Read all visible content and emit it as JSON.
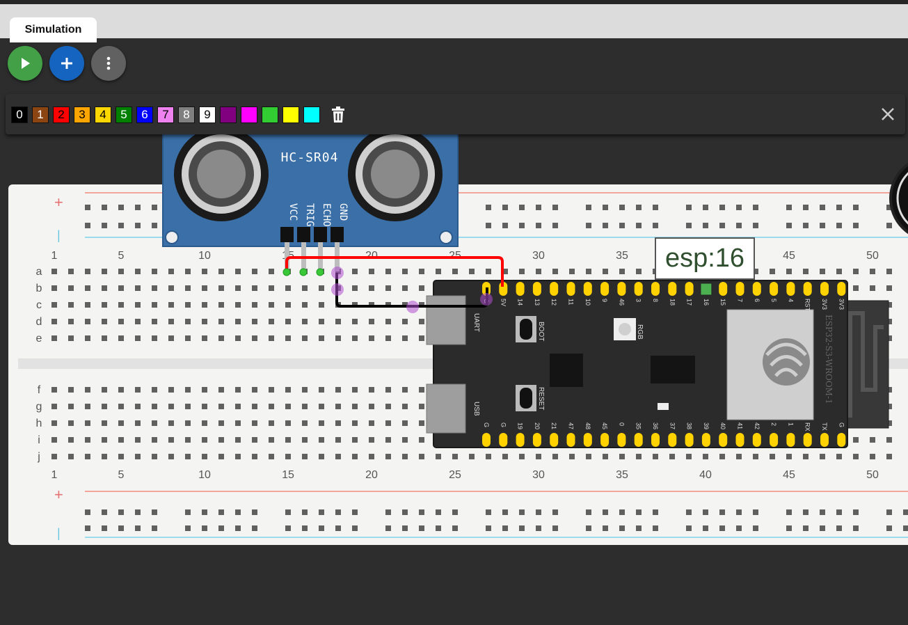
{
  "tabs": [
    {
      "label": "Simulation"
    }
  ],
  "toolbar": {
    "play": {
      "icon": "play-icon",
      "color": "#43a047"
    },
    "add": {
      "icon": "plus-icon",
      "color": "#1565c0"
    },
    "more": {
      "icon": "more-vert-icon",
      "color": "#616161"
    }
  },
  "palette": {
    "swatches": [
      {
        "label": "0",
        "color": "#000000",
        "text_color": "#ffffff"
      },
      {
        "label": "1",
        "color": "#8b4513",
        "text_color": "#ffffff"
      },
      {
        "label": "2",
        "color": "#ff0000",
        "text_color": "#000000"
      },
      {
        "label": "3",
        "color": "#ffa500",
        "text_color": "#000000"
      },
      {
        "label": "4",
        "color": "#ffd700",
        "text_color": "#000000"
      },
      {
        "label": "5",
        "color": "#008000",
        "text_color": "#ffffff"
      },
      {
        "label": "6",
        "color": "#0000ff",
        "text_color": "#ffffff"
      },
      {
        "label": "7",
        "color": "#ee82ee",
        "text_color": "#000000"
      },
      {
        "label": "8",
        "color": "#808080",
        "text_color": "#ffffff"
      },
      {
        "label": "9",
        "color": "#ffffff",
        "text_color": "#000000"
      },
      {
        "label": "",
        "color": "#800080"
      },
      {
        "label": "",
        "color": "#ff00ff"
      },
      {
        "label": "",
        "color": "#32cd32"
      },
      {
        "label": "",
        "color": "#ffff00"
      },
      {
        "label": "",
        "color": "#00ffff"
      }
    ],
    "delete_icon": "trash-icon",
    "close_icon": "close-icon"
  },
  "breadboard": {
    "column_numbers": [
      "1",
      "5",
      "10",
      "15",
      "20",
      "25",
      "30",
      "35",
      "40",
      "45",
      "50"
    ],
    "rows_top": [
      "a",
      "b",
      "c",
      "d",
      "e"
    ],
    "rows_bottom": [
      "f",
      "g",
      "h",
      "i",
      "j"
    ],
    "plus": "+",
    "minus": "|"
  },
  "sensor": {
    "name": "HC-SR04",
    "pins": [
      "VCC",
      "TRIG",
      "ECHO",
      "GND"
    ]
  },
  "esp32": {
    "module_label": "ESP32-S3-WROOM-1",
    "top_pins": [
      "G",
      "5V",
      "14",
      "13",
      "12",
      "11",
      "10",
      "9",
      "46",
      "3",
      "8",
      "18",
      "17",
      "16",
      "15",
      "7",
      "6",
      "5",
      "4",
      "RST",
      "3V3",
      "3V3"
    ],
    "bottom_pins": [
      "G",
      "G",
      "19",
      "20",
      "21",
      "47",
      "48",
      "45",
      "0",
      "35",
      "36",
      "37",
      "38",
      "39",
      "40",
      "41",
      "42",
      "2",
      "1",
      "RX",
      "TX",
      "G"
    ],
    "labels": {
      "uart": "UART",
      "usb": "USB",
      "boot": "BOOT",
      "reset": "RESET",
      "rgb": "RGB"
    },
    "tooltip": "esp:16"
  },
  "wires": [
    {
      "from": "VCC",
      "to": "5V",
      "color": "#ff0000"
    },
    {
      "from": "GND",
      "to": "G",
      "color": "#000000"
    }
  ]
}
